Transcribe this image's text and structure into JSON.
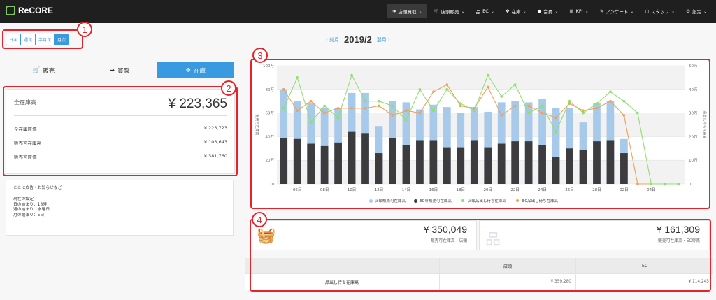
{
  "app": {
    "logo_text": "ReCORE"
  },
  "nav": [
    {
      "label": "店頭買取",
      "icon": "sign-in-icon",
      "active": true
    },
    {
      "label": "店頭販売",
      "icon": "cart-icon"
    },
    {
      "label": "EC",
      "icon": "sitemap-icon"
    },
    {
      "label": "在庫",
      "icon": "cubes-icon"
    },
    {
      "label": "会員",
      "icon": "user-icon"
    },
    {
      "label": "KPI",
      "icon": "bar-chart-icon"
    },
    {
      "label": "アンケート",
      "icon": "edit-icon"
    },
    {
      "label": "スタッフ",
      "icon": "user-outline-icon"
    },
    {
      "label": "設定",
      "icon": "gear-icon"
    }
  ],
  "period": {
    "options": [
      "日次",
      "週次",
      "半月次",
      "月次"
    ],
    "selected": "月次"
  },
  "month_nav": {
    "prev": "‹ 前月",
    "title": "2019/2",
    "next": "翌月 ›"
  },
  "tabs": [
    {
      "label": "販売",
      "icon": "cart-icon"
    },
    {
      "label": "買取",
      "icon": "sign-in-icon"
    },
    {
      "label": "在庫",
      "icon": "cubes-icon",
      "active": true
    }
  ],
  "stock": {
    "heading": "全在庫高",
    "total": "¥ 223,365",
    "rows": [
      {
        "label": "全在庫原価",
        "value": "¥ 223,723"
      },
      {
        "label": "販売可在庫高",
        "value": "¥ 103,643"
      },
      {
        "label": "販売可原価",
        "value": "¥ 381,760"
      }
    ]
  },
  "notice": {
    "line1": "ここに広告・お知らせなど",
    "line2": "現在の設定",
    "line3": "日の始まり：18時",
    "line4": "週の始まり：水曜日",
    "line5": "月の始まり：5日"
  },
  "markers": [
    "1",
    "2",
    "3",
    "4"
  ],
  "chart_data": {
    "type": "bar",
    "x": [
      "05日",
      "06日",
      "07日",
      "08日",
      "09日",
      "10日",
      "11日",
      "12日",
      "13日",
      "14日",
      "15日",
      "16日",
      "17日",
      "18日",
      "19日",
      "20日",
      "21日",
      "22日",
      "23日",
      "24日",
      "25日",
      "26日",
      "27日",
      "28日",
      "01日",
      "02日",
      "03日",
      "04日"
    ],
    "tick_labels": [
      "06日",
      "08日",
      "10日",
      "12日",
      "14日",
      "16日",
      "18日",
      "20日",
      "22日",
      "24日",
      "26日",
      "28日",
      "02日",
      "04日"
    ],
    "y_left": {
      "label": "販売可在庫高",
      "ticks": [
        "0",
        "20万",
        "40万",
        "60万",
        "80万",
        "100万"
      ],
      "max": 100
    },
    "y_right": {
      "label": "品出し待ち在庫高",
      "ticks": [
        "0",
        "10万",
        "20万",
        "30万",
        "40万",
        "50万"
      ],
      "max": 50
    },
    "series": [
      {
        "name": "店頭販売可在庫高",
        "axis": "left",
        "color": "#a7c9ea",
        "values": [
          80,
          70,
          68,
          64,
          64,
          77,
          77,
          49,
          70,
          69,
          63,
          67,
          65,
          60,
          65,
          61,
          69,
          70,
          69,
          72,
          64,
          64,
          52,
          68,
          70,
          38,
          0,
          0,
          0,
          0
        ]
      },
      {
        "name": "EC専販売可在庫高",
        "axis": "left",
        "color": "#3c3c3e",
        "values": [
          39,
          38,
          34,
          32,
          35,
          44,
          43,
          26,
          39,
          33,
          37,
          37,
          31,
          31,
          37,
          31,
          34,
          36,
          36,
          33,
          23,
          30,
          29,
          36,
          37,
          26,
          0,
          0,
          0,
          0
        ]
      },
      {
        "name": "店頭品出し待ち在庫高",
        "axis": "right",
        "color": "#8ee06d",
        "values": [
          32,
          45,
          26,
          33,
          28,
          46,
          35,
          35,
          33,
          27,
          40,
          31,
          40,
          34,
          31,
          46,
          37,
          42,
          30,
          33,
          22,
          35,
          30,
          34,
          39,
          35,
          30,
          0,
          0,
          0,
          0
        ]
      },
      {
        "name": "EC品出し待ち在庫高",
        "axis": "right",
        "color": "#f0a05a",
        "values": [
          40,
          31,
          35,
          30,
          32,
          32,
          32,
          33,
          29,
          31,
          30,
          39,
          42,
          33,
          32,
          41,
          29,
          33,
          33,
          30,
          28,
          34,
          31,
          32,
          35,
          29,
          0,
          0,
          0,
          0
        ]
      }
    ]
  },
  "summary": [
    {
      "value": "¥ 350,049",
      "label": "販売可在庫高・店頭",
      "icon": "basket-icon"
    },
    {
      "value": "¥ 161,309",
      "label": "販売可在庫高・EC専売",
      "icon": "sitemap-icon"
    }
  ],
  "table": {
    "headers": [
      "",
      "店頭",
      "EC"
    ],
    "row": {
      "label": "品出し待ち在庫高",
      "store": "¥ 359,280",
      "ec": "¥ 114,245"
    }
  }
}
